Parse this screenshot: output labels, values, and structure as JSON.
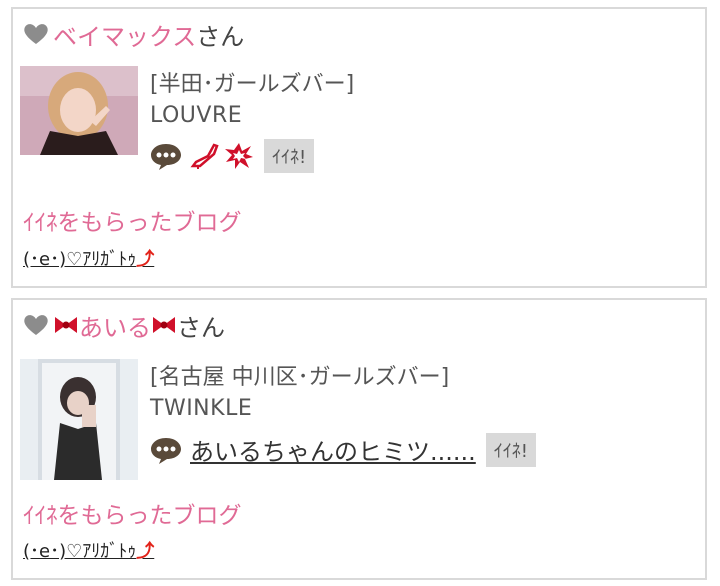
{
  "entries": [
    {
      "name": "ベイマックス",
      "honorific": "さん",
      "area": "[半田･ガールズバー]",
      "shop": "LOUVRE",
      "blog_title": "",
      "like_label": "ｲｲﾈ!",
      "received_label": "ｲｲﾈをもらったブログ",
      "thanks_text": "(･e･)♡ｱﾘｶﾞﾄｩ",
      "thanks_arrow": "⤴"
    },
    {
      "name": "あいる",
      "honorific": "さん",
      "area": "[名古屋 中川区･ガールズバー]",
      "shop": "TWINKLE",
      "blog_title": "あいるちゃんのヒミツ......",
      "like_label": "ｲｲﾈ!",
      "received_label": "ｲｲﾈをもらったブログ",
      "thanks_text": "(･e･)♡ｱﾘｶﾞﾄｩ",
      "thanks_arrow": "⤴"
    }
  ],
  "colors": {
    "name": "#e06a95",
    "heart": "#8c8c8c",
    "border": "#d9d9d9",
    "like_bg": "#d9d9d9"
  }
}
